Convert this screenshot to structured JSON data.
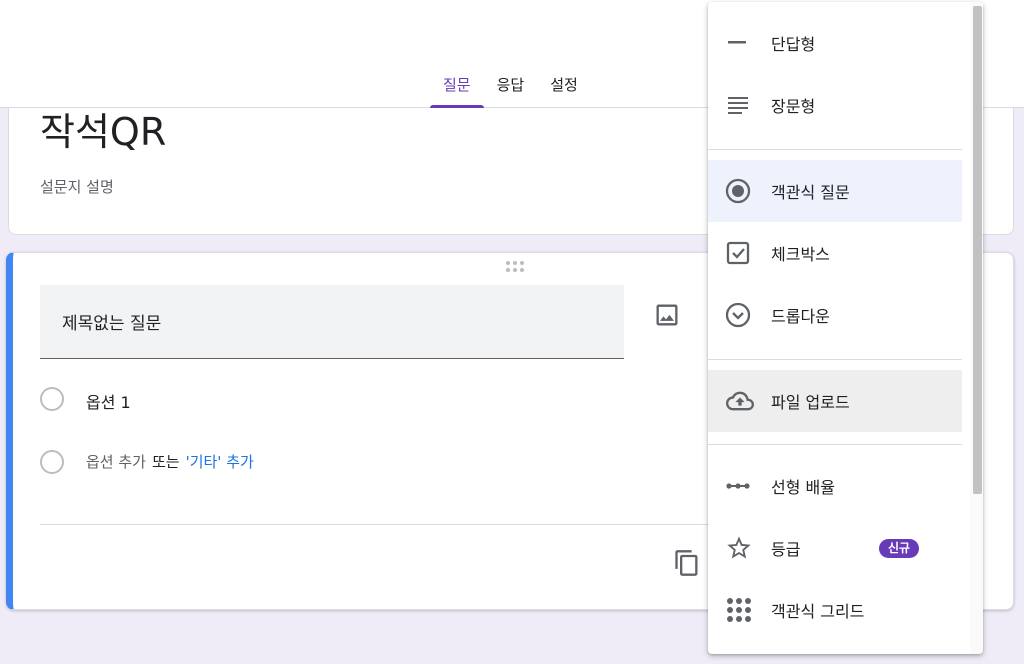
{
  "tabs": [
    {
      "label": "질문",
      "active": true
    },
    {
      "label": "응답",
      "active": false
    },
    {
      "label": "설정",
      "active": false
    }
  ],
  "form": {
    "title": "작석QR",
    "description": "설문지 설명"
  },
  "question": {
    "title": "제목없는 질문",
    "options": [
      "옵션 1"
    ],
    "add_option": "옵션 추가",
    "or": "또는",
    "add_other": "'기타' 추가"
  },
  "type_menu": {
    "items": [
      {
        "label": "단답형",
        "icon": "short-answer-icon"
      },
      {
        "label": "장문형",
        "icon": "paragraph-icon"
      },
      {
        "label": "객관식 질문",
        "icon": "radio-button-icon",
        "selected": true
      },
      {
        "label": "체크박스",
        "icon": "checkbox-icon"
      },
      {
        "label": "드롭다운",
        "icon": "dropdown-icon"
      },
      {
        "label": "파일 업로드",
        "icon": "cloud-upload-icon",
        "hovered": true
      },
      {
        "label": "선형 배율",
        "icon": "linear-scale-icon"
      },
      {
        "label": "등급",
        "icon": "star-icon",
        "badge": "신규"
      },
      {
        "label": "객관식 그리드",
        "icon": "grid-icon"
      }
    ]
  },
  "colors": {
    "accent": "#673ab7",
    "question_border": "#4285f4",
    "link": "#1a73e8",
    "background": "#efebf7"
  }
}
